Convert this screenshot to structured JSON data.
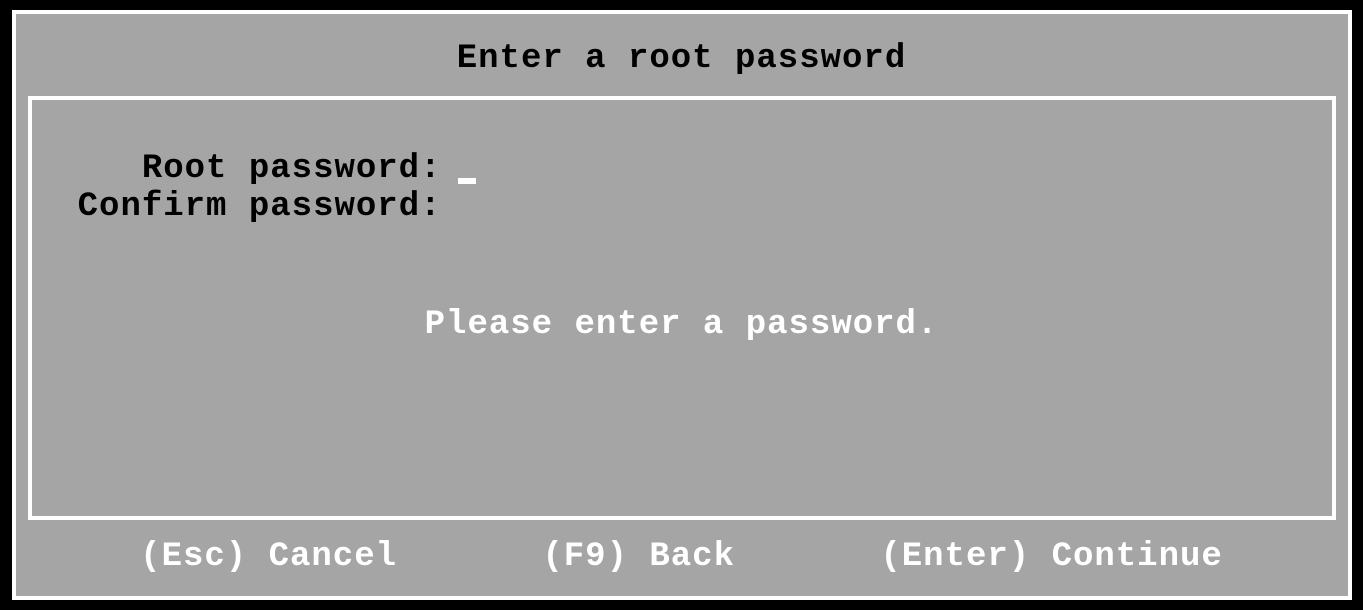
{
  "dialog": {
    "title": "Enter a root password",
    "fields": {
      "root_password": {
        "label": "Root password:",
        "value": ""
      },
      "confirm_password": {
        "label": "Confirm password:",
        "value": ""
      }
    },
    "message": "Please enter a password."
  },
  "footer": {
    "cancel": "(Esc) Cancel",
    "back": "(F9) Back",
    "continue": "(Enter) Continue"
  }
}
